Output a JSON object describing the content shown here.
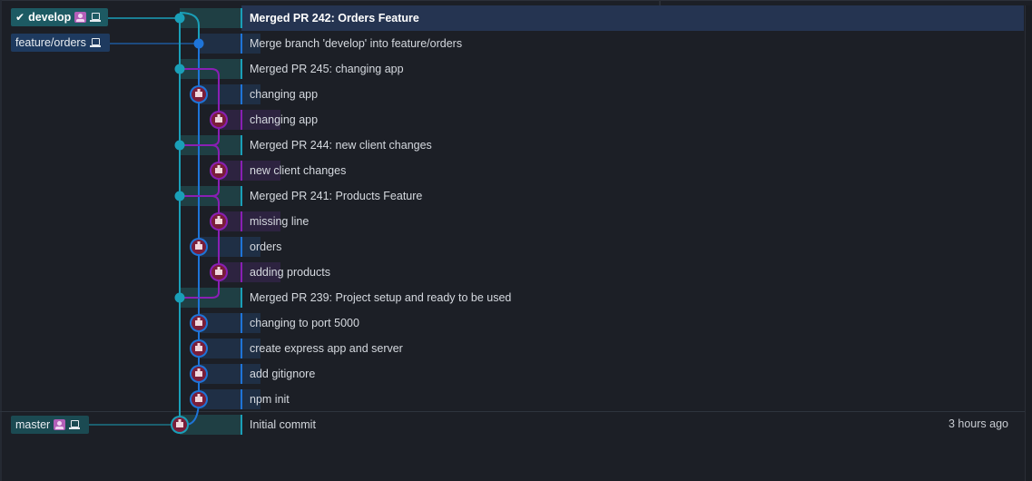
{
  "refs": [
    {
      "name": "develop",
      "icons": [
        "check-icon",
        "user-avatar-icon",
        "laptop-icon"
      ]
    },
    {
      "name": "feature/orders",
      "icons": [
        "laptop-icon"
      ]
    },
    {
      "name": "master",
      "icons": [
        "user-avatar-icon",
        "laptop-icon"
      ]
    }
  ],
  "commits": [
    {
      "message": "Merged PR 242: Orders Feature",
      "time": "",
      "selected": true
    },
    {
      "message": "Merge branch 'develop' into feature/orders",
      "time": ""
    },
    {
      "message": "Merged PR 245: changing app",
      "time": ""
    },
    {
      "message": "changing app",
      "time": ""
    },
    {
      "message": "changing app",
      "time": ""
    },
    {
      "message": "Merged PR 244: new client changes",
      "time": ""
    },
    {
      "message": "new client changes",
      "time": ""
    },
    {
      "message": "Merged PR 241: Products Feature",
      "time": ""
    },
    {
      "message": "missing line",
      "time": ""
    },
    {
      "message": "orders",
      "time": ""
    },
    {
      "message": "adding products",
      "time": ""
    },
    {
      "message": "Merged PR 239: Project setup and ready to be used",
      "time": ""
    },
    {
      "message": "changing to port 5000",
      "time": ""
    },
    {
      "message": "create express app and server",
      "time": ""
    },
    {
      "message": "add gitignore",
      "time": ""
    },
    {
      "message": "npm init",
      "time": ""
    },
    {
      "message": "Initial commit",
      "time": "3 hours ago"
    }
  ],
  "colors": {
    "develop": "#1a9fb8",
    "feature": "#1e74d8",
    "purple": "#8a1fb4",
    "background": "#1c1f26",
    "selected_row": "#253451"
  }
}
